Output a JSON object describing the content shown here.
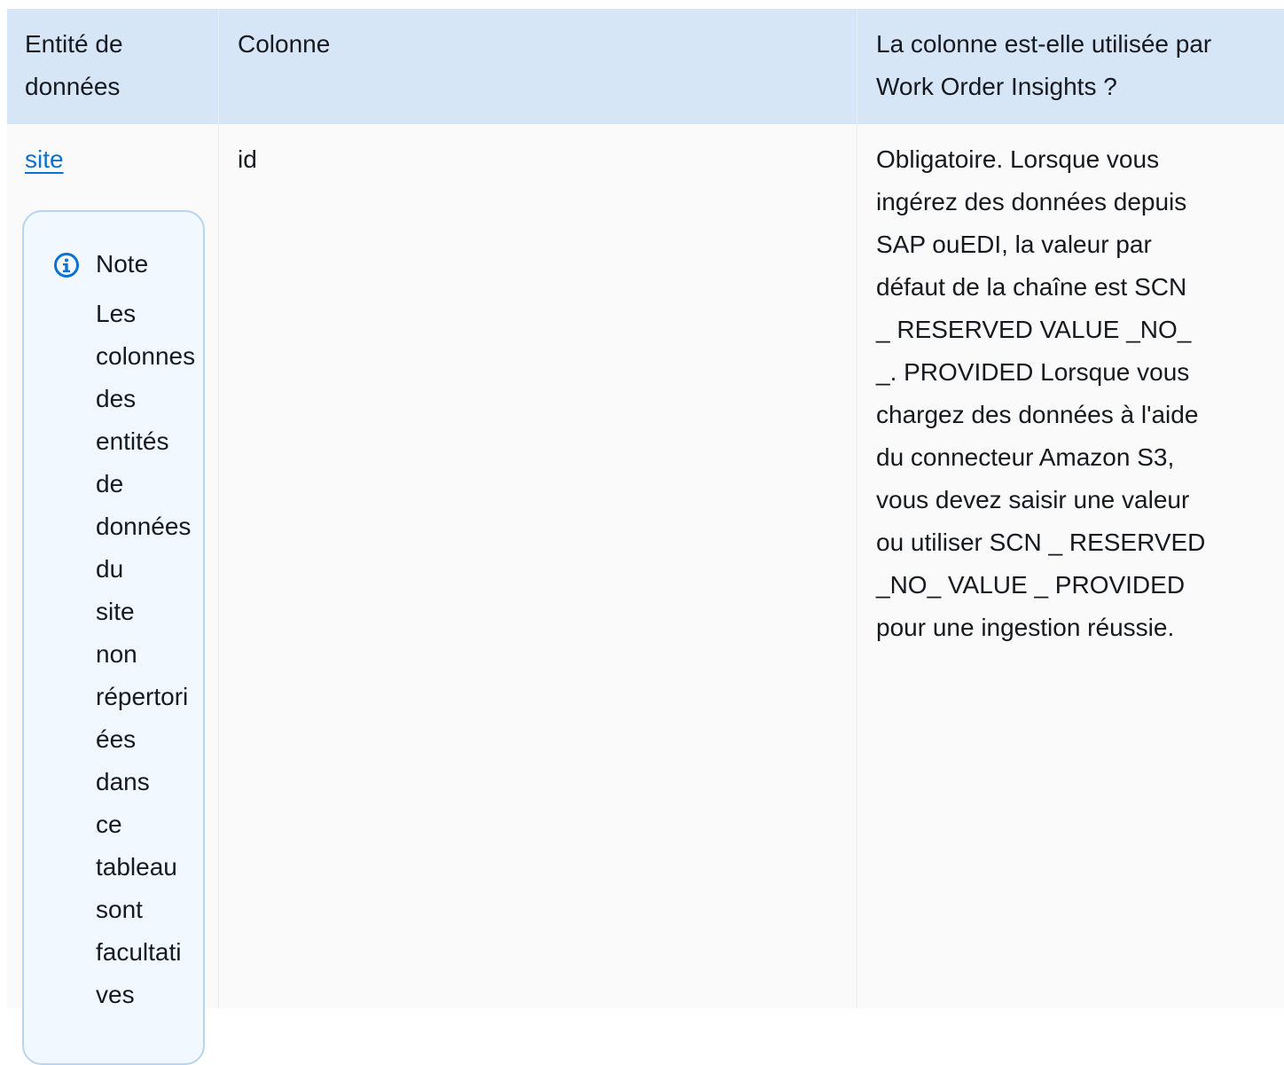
{
  "table": {
    "headers": [
      "Entité de données",
      "Colonne",
      "La colonne est-elle utilisée par Work Order Insights ?"
    ],
    "header_lines": {
      "col1": [
        "Entité de",
        "données"
      ],
      "col2": [
        "Colonne"
      ],
      "col3": [
        "La colonne est-elle utilisée par",
        "Work Order Insights ?"
      ]
    },
    "row": {
      "entity_link": "site",
      "note": {
        "title": "Note",
        "body_lines": [
          "Les",
          "colonnes",
          "des",
          "entités",
          "de",
          "données",
          "du",
          "site",
          "non",
          "répertori",
          "ées",
          "dans",
          "ce",
          "tableau",
          "sont",
          "facultati",
          "ves"
        ]
      },
      "column": "id",
      "usage_lines": [
        "Obligatoire. Lorsque vous",
        "ingérez des données depuis",
        "SAP ouEDI, la valeur par",
        "défaut de la chaîne est SCN",
        "_ RESERVED VALUE _NO_",
        "_. PROVIDED Lorsque vous",
        "chargez des données à l'aide",
        "du connecteur Amazon S3,",
        "vous devez saisir une valeur",
        "ou utiliser SCN _ RESERVED",
        "_NO_ VALUE _ PROVIDED",
        "pour une ingestion réussie."
      ]
    }
  },
  "icons": {
    "note_icon": "info-circle-icon"
  },
  "colors": {
    "header_bg": "#d6e6f6",
    "link": "#0972d3",
    "note_border": "#b9d4ee",
    "note_bg": "#f1f8ff",
    "icon": "#0972d3"
  }
}
